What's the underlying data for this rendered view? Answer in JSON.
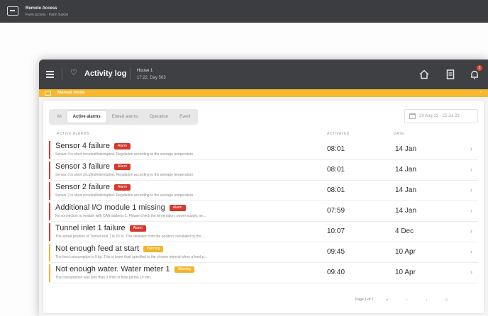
{
  "remote_bar": {
    "title": "Remote Access",
    "subtitle": "Farm access · Farm Saxon"
  },
  "topbar": {
    "title": "Activity log",
    "house_name": "House 1",
    "house_detail": "17:22, Day 563",
    "notification_count": "1"
  },
  "manual_bar": {
    "label": "Manual mode",
    "close": "×"
  },
  "tabs": [
    {
      "label": "All",
      "active": false
    },
    {
      "label": "Active alarms",
      "active": true
    },
    {
      "label": "Ended alarms",
      "active": false
    },
    {
      "label": "Operation",
      "active": false
    },
    {
      "label": "Event",
      "active": false
    }
  ],
  "date_range": "29 Aug 22 - 25 Jul 23",
  "columns": {
    "alarm": "ACTIVE ALARMS",
    "activated": "ACTIVATED",
    "date": "DATE"
  },
  "rows": [
    {
      "title": "Sensor 4 failure",
      "badge": "Alarm",
      "severity": "alarm",
      "description": "Sensor 4 is short circuited/interrupted. Regulation according to the average temperature",
      "time": "08:01",
      "date": "14 Jan"
    },
    {
      "title": "Sensor 3 failure",
      "badge": "Alarm",
      "severity": "alarm",
      "description": "Sensor 3 is short circuited/interrupted. Regulation according to the average temperature",
      "time": "08:01",
      "date": "14 Jan"
    },
    {
      "title": "Sensor 2 failure",
      "badge": "Alarm",
      "severity": "alarm",
      "description": "Sensor 2 is short circuited/interrupted. Regulation according to the average temperature",
      "time": "08:01",
      "date": "14 Jan"
    },
    {
      "title": "Additional I/O module 1 missing",
      "badge": "Alarm",
      "severity": "alarm",
      "description": "No connection to module with CAN address 1. Please check the termination, power supply, ne...",
      "time": "07:59",
      "date": "14 Jan"
    },
    {
      "title": "Tunnel inlet 1 failure",
      "badge": "Alarm",
      "severity": "alarm",
      "description": "The actual position of Tunnel inlet 1 is 20 %. This deviates from the position calculated by the ...",
      "time": "10:07",
      "date": "4 Dec"
    },
    {
      "title": "Not enough feed at start",
      "badge": "Warning",
      "severity": "warning",
      "description": "The feed consumption is 0 kg. This is lower than specified in the chosen interval when a feed p...",
      "time": "09:45",
      "date": "10 Apr"
    },
    {
      "title": "Not enough water. Water meter 1",
      "badge": "Warning",
      "severity": "warning",
      "description": "The consumption was less than 3 l/min in time period 10 min.",
      "time": "09:40",
      "date": "10 Apr"
    }
  ],
  "pagination": {
    "label": "Page 1 of 1",
    "first": "«",
    "prev": "‹",
    "next": "›",
    "last": "»"
  },
  "colors": {
    "topbar": "#3e4043",
    "manual_mode": "#f5b82e",
    "alarm": "#d8382c",
    "warning": "#f2b42a"
  },
  "icons": {
    "remote": "remote-access-icon",
    "menu": "hamburger-menu-icon",
    "bell": "bell-icon",
    "home": "home-icon",
    "document": "document-icon",
    "notifications": "notifications-icon",
    "manual": "manual-mode-icon",
    "calendar": "calendar-icon",
    "row_open": "chevron-right-icon"
  }
}
